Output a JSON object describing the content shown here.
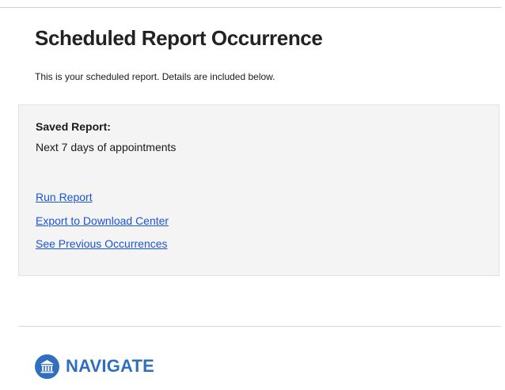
{
  "email": {
    "title": "Scheduled Report Occurrence",
    "subtitle": "This is your scheduled report. Details are included below."
  },
  "report": {
    "saved_label": "Saved Report:",
    "saved_name": "Next 7 days of appointments",
    "links": {
      "run": "Run Report",
      "export": "Export to Download Center",
      "previous": "See Previous Occurrences"
    }
  },
  "footer": {
    "brand_name": "NAVIGATE",
    "brand_icon": "institution-icon"
  },
  "colors": {
    "link": "#1a55d6",
    "brand": "#2f6fbd",
    "panel_background": "#f4f4f4"
  }
}
